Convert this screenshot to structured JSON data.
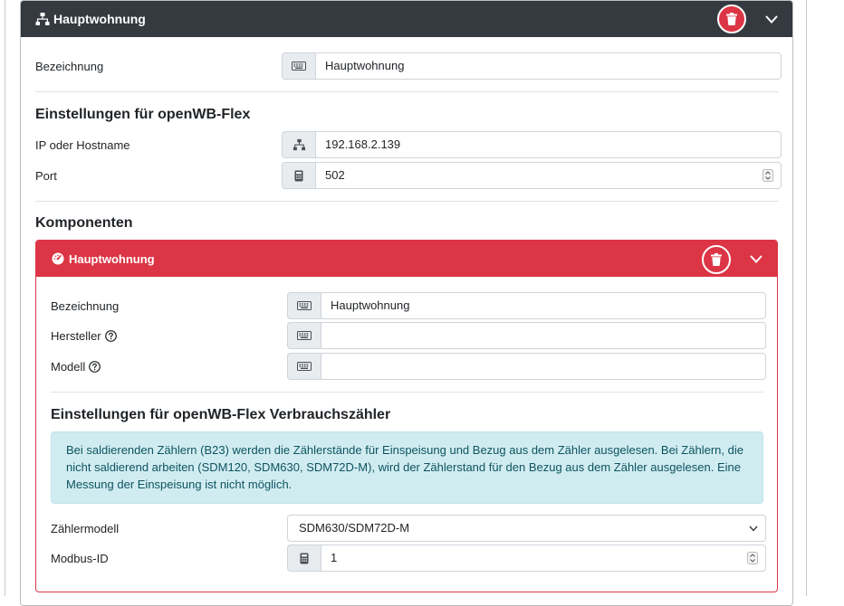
{
  "device": {
    "title": "Hauptwohnung",
    "name_label": "Bezeichnung",
    "name_value": "Hauptwohnung",
    "settings_heading": "Einstellungen für openWB-Flex",
    "ip_label": "IP oder Hostname",
    "ip_value": "192.168.2.139",
    "port_label": "Port",
    "port_value": "502"
  },
  "components": {
    "heading": "Komponenten",
    "items": [
      {
        "title": "Hauptwohnung",
        "name_label": "Bezeichnung",
        "name_value": "Hauptwohnung",
        "manufacturer_label": "Hersteller",
        "manufacturer_value": "",
        "model_label": "Modell",
        "model_value": "",
        "settings_heading": "Einstellungen für openWB-Flex Verbrauchszähler",
        "info_text": "Bei saldierenden Zählern (B23) werden die Zählerstände für Einspeisung und Bezug aus dem Zähler ausgelesen. Bei Zählern, die nicht saldierend arbeiten (SDM120, SDM630, SDM72D-M), wird der Zählerstand für den Bezug aus dem Zähler ausgelesen. Eine Messung der Einspeisung ist nicht möglich.",
        "meter_model_label": "Zählermodell",
        "meter_model_value": "SDM630/SDM72D-M",
        "modbus_id_label": "Modbus-ID",
        "modbus_id_value": "1"
      }
    ]
  },
  "icons": {
    "device": "network-icon",
    "component": "gauge-icon",
    "delete": "trash-icon",
    "collapse": "chevron-down-icon",
    "text_addon": "keyboard-icon",
    "number_addon": "calculator-icon",
    "help": "question-circle-icon"
  },
  "colors": {
    "header_dark": "#343a40",
    "danger": "#dc3545",
    "info_bg": "#d1ecf1",
    "info_text": "#0c5460"
  }
}
